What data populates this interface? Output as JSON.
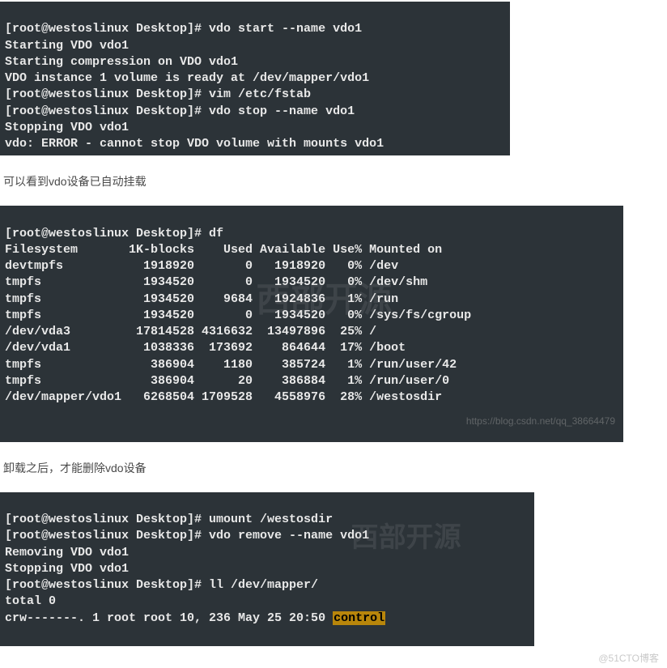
{
  "term1": {
    "l1": "[root@westoslinux Desktop]# vdo start --name vdo1",
    "l2": "Starting VDO vdo1",
    "l3": "Starting compression on VDO vdo1",
    "l4": "VDO instance 1 volume is ready at /dev/mapper/vdo1",
    "l5": "[root@westoslinux Desktop]# vim /etc/fstab",
    "l6": "[root@westoslinux Desktop]# vdo stop --name vdo1",
    "l7": "Stopping VDO vdo1",
    "l8": "vdo: ERROR - cannot stop VDO volume with mounts vdo1"
  },
  "caption1": "可以看到vdo设备已自动挂载",
  "term2": {
    "l1": "[root@westoslinux Desktop]# df",
    "l2": "Filesystem       1K-blocks    Used Available Use% Mounted on",
    "l3": "devtmpfs           1918920       0   1918920   0% /dev",
    "l4": "tmpfs              1934520       0   1934520   0% /dev/shm",
    "l5": "tmpfs              1934520    9684   1924836   1% /run",
    "l6": "tmpfs              1934520       0   1934520   0% /sys/fs/cgroup",
    "l7": "/dev/vda3         17814528 4316632  13497896  25% /",
    "l8": "/dev/vda1          1038336  173692    864644  17% /boot",
    "l9": "tmpfs               386904    1180    385724   1% /run/user/42",
    "l10": "tmpfs               386904      20    386884   1% /run/user/0",
    "l11": "/dev/mapper/vdo1   6268504 1709528   4558976  28% /westosdir",
    "wm_cn": "西部开源",
    "wm_url": "https://blog.csdn.net/qq_38664479"
  },
  "caption2": "卸载之后，才能删除vdo设备",
  "term3": {
    "l1": "[root@westoslinux Desktop]# umount /westosdir",
    "l2": "[root@westoslinux Desktop]# vdo remove --name vdo1",
    "l3": "Removing VDO vdo1",
    "l4": "Stopping VDO vdo1",
    "l5": "[root@westoslinux Desktop]# ll /dev/mapper/",
    "l6": "total 0",
    "l7a": "crw-------. 1 root root 10, 236 May 25 20:50 ",
    "l7b": "control",
    "wm_cn": "西部开源"
  },
  "footer": "@51CTO博客"
}
